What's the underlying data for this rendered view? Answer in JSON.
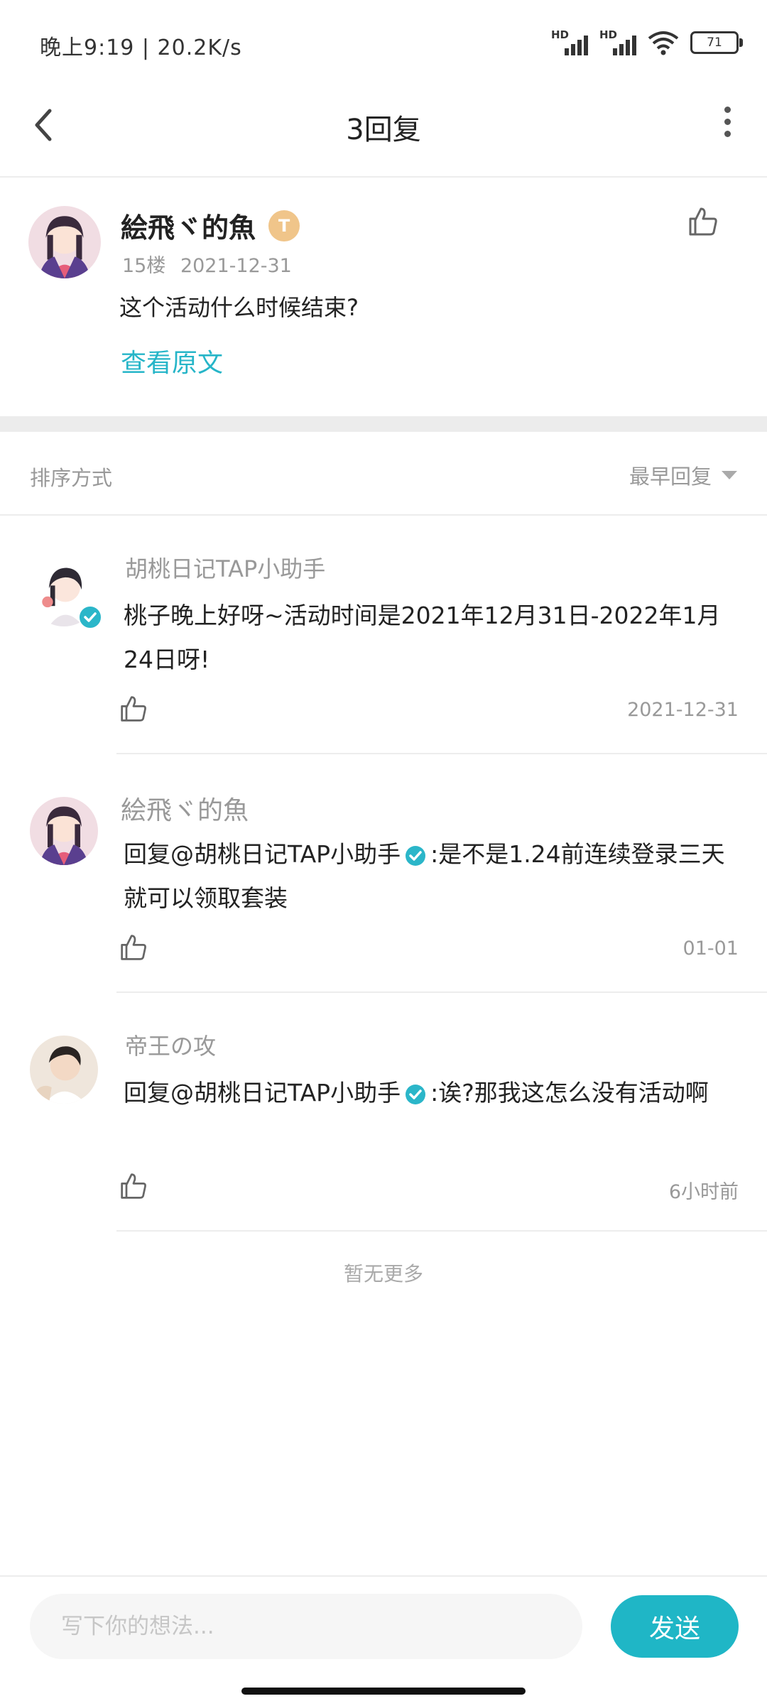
{
  "status_bar": {
    "text": "晚上9:19 | 20.2K/s",
    "network_1": "HD",
    "network_2": "HD",
    "battery": "71"
  },
  "header": {
    "title": "3回复"
  },
  "post": {
    "author": "絵飛ヾ的魚",
    "level": "T",
    "floor": "15楼",
    "date": "2021-12-31",
    "content": "这个活动什么时候结束?",
    "view_original": "查看原文"
  },
  "sort": {
    "label": "排序方式",
    "selected": "最早回复"
  },
  "replies": [
    {
      "author": "胡桃日记TAP小助手",
      "text": "桃子晚上好呀~活动时间是2021年12月31日-2022年1月24日呀!",
      "time": "2021-12-31"
    },
    {
      "author": "絵飛ヾ的魚",
      "reply_to": "回复@胡桃日记TAP小助手",
      "text": ":是不是1.24前连续登录三天就可以领取套装",
      "time": "01-01"
    },
    {
      "author": "帝王の攻",
      "reply_to": "回复@胡桃日记TAP小助手",
      "text": ":诶?那我这怎么没有活动啊",
      "time": "6小时前"
    }
  ],
  "footer": {
    "no_more": "暂无更多"
  },
  "composer": {
    "placeholder": "写下你的想法...",
    "send_label": "发送"
  },
  "colors": {
    "accent": "#1fb6c6",
    "link": "#26b5c8",
    "muted_text": "#999999",
    "badge_gold": "#f0c58a"
  }
}
